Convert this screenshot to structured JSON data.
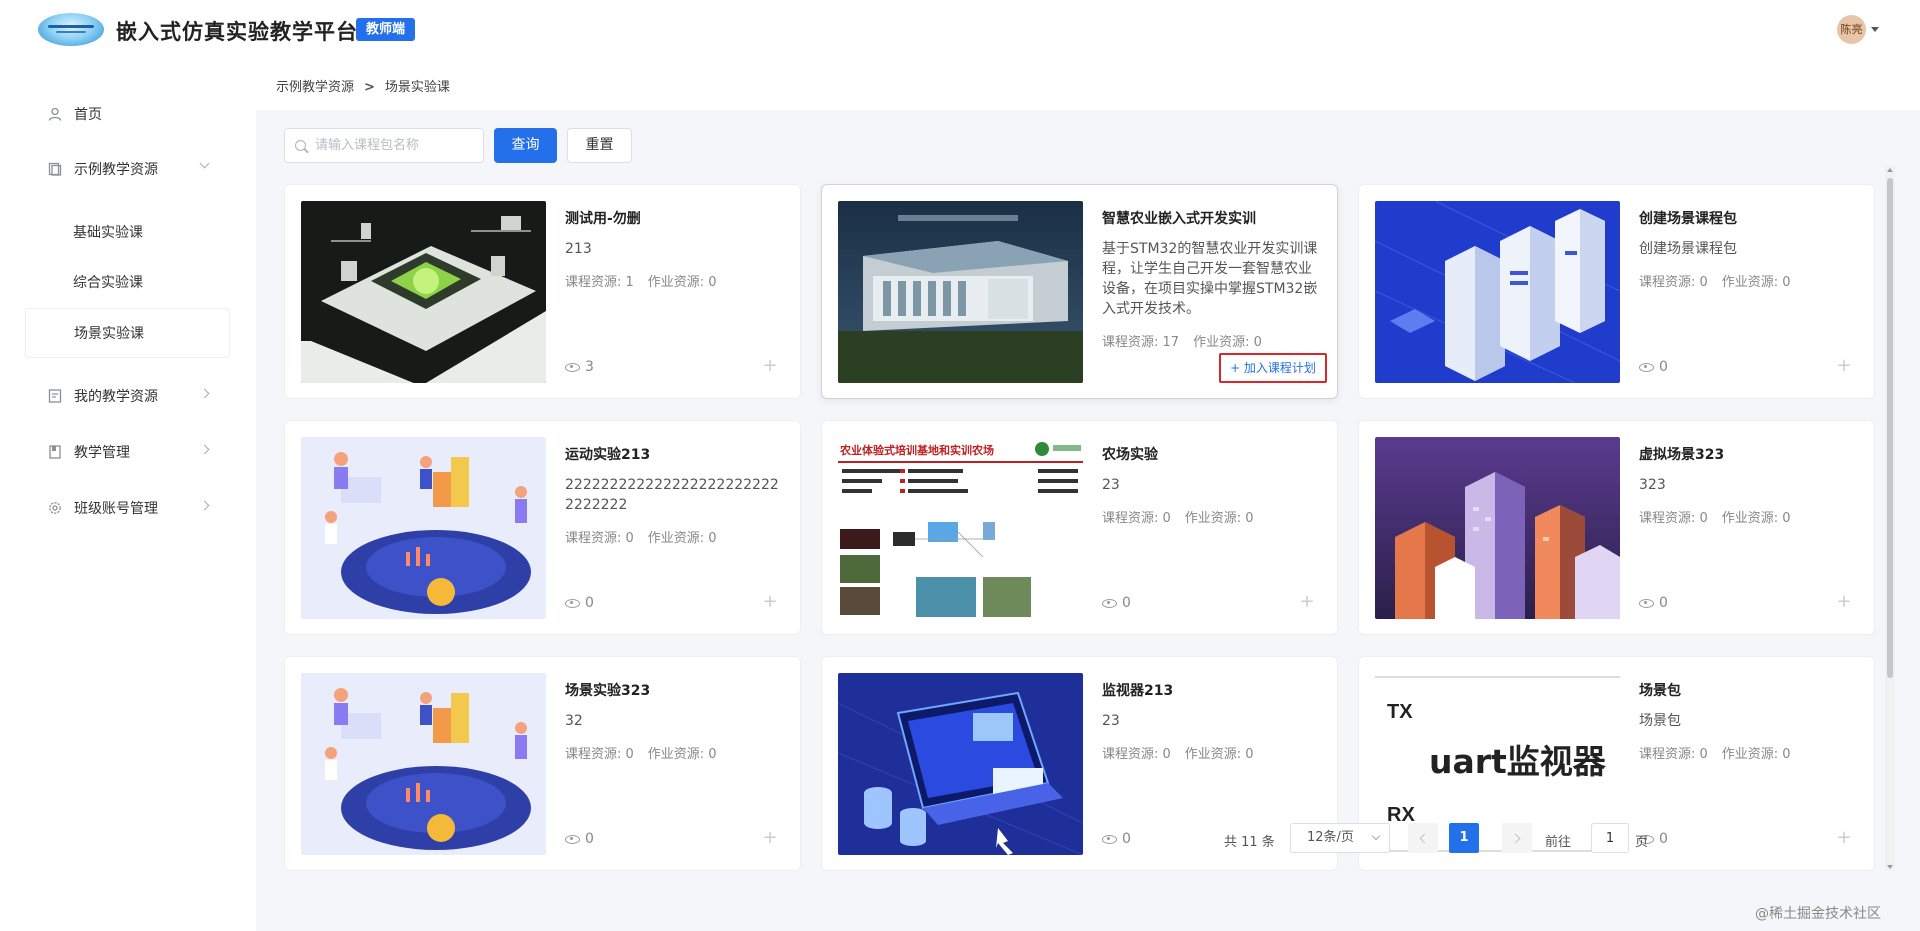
{
  "header": {
    "app_title": "嵌入式仿真实验教学平台",
    "role_badge": "教师端",
    "user_name": "陈亮"
  },
  "sidebar": {
    "items": [
      {
        "label": "首页",
        "icon": "user-icon"
      },
      {
        "label": "示例教学资源",
        "icon": "book-icon",
        "expanded": true
      },
      {
        "label": "我的教学资源",
        "icon": "document-icon"
      },
      {
        "label": "教学管理",
        "icon": "bookmark-icon"
      },
      {
        "label": "班级账号管理",
        "icon": "gear-icon"
      }
    ],
    "sub_items": [
      {
        "label": "基础实验课"
      },
      {
        "label": "综合实验课"
      },
      {
        "label": "场景实验课",
        "active": true
      }
    ]
  },
  "breadcrumb": {
    "parent": "示例教学资源",
    "separator": ">",
    "current": "场景实验课"
  },
  "search": {
    "placeholder": "请输入课程包名称",
    "query_label": "查询",
    "reset_label": "重置"
  },
  "cards": [
    {
      "title": "测试用-勿删",
      "desc": "213",
      "course_res": "课程资源: 1",
      "hw_res": "作业资源: 0",
      "views": "3"
    },
    {
      "title": "智慧农业嵌入式开发实训",
      "desc": "基于STM32的智慧农业开发实训课程，让学生自己开发一套智慧农业设备，在项目实操中掌握STM32嵌入式开发技术。",
      "course_res": "课程资源: 17",
      "hw_res": "作业资源: 0",
      "add_plan": "+ 加入课程计划"
    },
    {
      "title": "创建场景课程包",
      "desc": "创建场景课程包",
      "course_res": "课程资源: 0",
      "hw_res": "作业资源: 0",
      "views": "0"
    },
    {
      "title": "运动实验213",
      "desc": "2222222222222222222222222222222",
      "course_res": "课程资源: 0",
      "hw_res": "作业资源: 0",
      "views": "0"
    },
    {
      "title": "农场实验",
      "desc": "23",
      "course_res": "课程资源: 0",
      "hw_res": "作业资源: 0",
      "views": "0"
    },
    {
      "title": "虚拟场景323",
      "desc": "323",
      "course_res": "课程资源: 0",
      "hw_res": "作业资源: 0",
      "views": "0"
    },
    {
      "title": "场景实验323",
      "desc": "32",
      "course_res": "课程资源: 0",
      "hw_res": "作业资源: 0",
      "views": "0"
    },
    {
      "title": "监视器213",
      "desc": "23",
      "course_res": "课程资源: 0",
      "hw_res": "作业资源: 0",
      "views": "0"
    },
    {
      "title": "场景包",
      "desc": "场景包",
      "course_res": "课程资源: 0",
      "hw_res": "作业资源: 0",
      "views": "0"
    }
  ],
  "thumb_text": {
    "farm_banner": "农业体验式培训基地和实训农场",
    "uart_tx": "TX",
    "uart_rx": "RX",
    "uart_title": "uart监视器"
  },
  "pagination": {
    "total": "共 11 条",
    "page_size": "12条/页",
    "current_page": "1",
    "goto_prefix": "前往",
    "goto_value": "1",
    "goto_suffix": "页"
  },
  "watermark": "@稀土掘金技术社区",
  "colors": {
    "primary": "#2470ea",
    "highlight_border": "#d9262b",
    "sidebar_bg": "#ffffff",
    "content_bg": "#f4f6f9"
  }
}
